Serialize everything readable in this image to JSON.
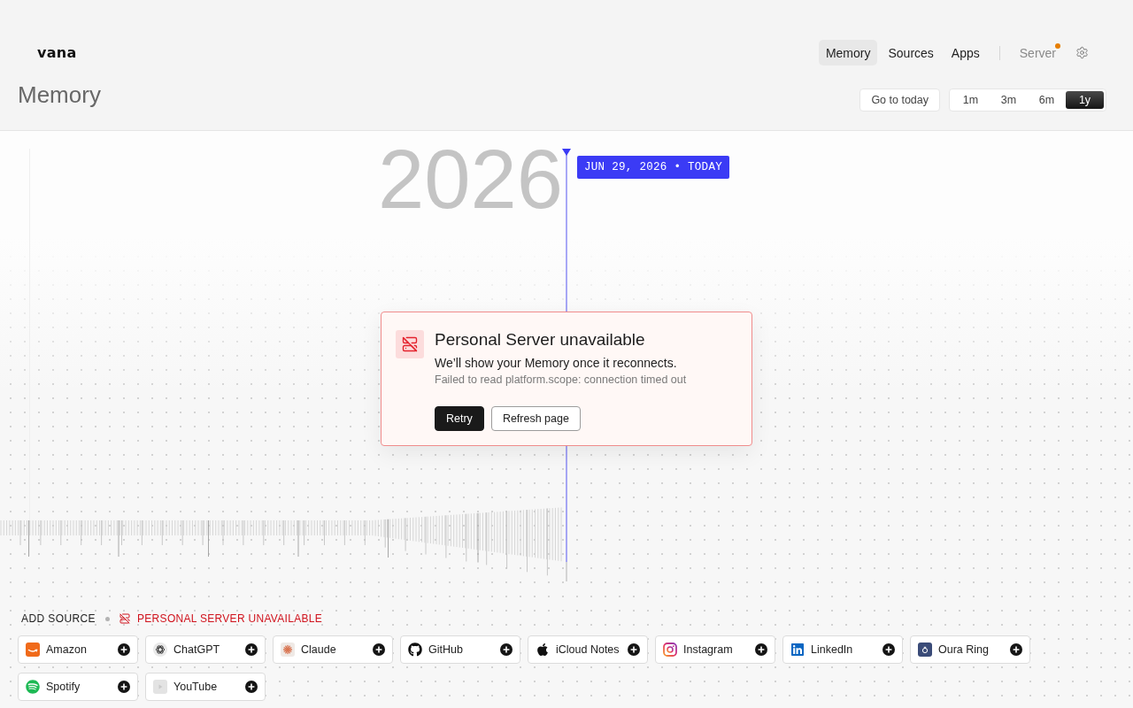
{
  "header": {
    "logo": "vana",
    "nav": [
      {
        "label": "Memory",
        "selected": true
      },
      {
        "label": "Sources",
        "selected": false
      },
      {
        "label": "Apps",
        "selected": false
      }
    ],
    "server_link": {
      "label": "Server",
      "alert": true
    }
  },
  "page_title": "Memory",
  "toolbar": {
    "today_button": "Go to today",
    "ranges": [
      {
        "label": "1m",
        "selected": false
      },
      {
        "label": "3m",
        "selected": false
      },
      {
        "label": "6m",
        "selected": false
      },
      {
        "label": "1y",
        "selected": true
      }
    ]
  },
  "timeline": {
    "year_label": "2026",
    "today_badge": "JUN 29, 2026 • TODAY"
  },
  "error_dialog": {
    "title": "Personal Server unavailable",
    "message": "We’ll show your Memory once it reconnects.",
    "detail": "Failed to read platform.scope: connection timed out",
    "buttons": [
      {
        "label": "Retry",
        "kind": "primary"
      },
      {
        "label": "Refresh page",
        "kind": "secondary"
      }
    ]
  },
  "add_source": {
    "heading": "ADD SOURCE",
    "status": "PERSONAL SERVER UNAVAILABLE",
    "sources": [
      {
        "name": "Amazon"
      },
      {
        "name": "ChatGPT"
      },
      {
        "name": "Claude"
      },
      {
        "name": "GitHub"
      },
      {
        "name": "iCloud Notes"
      },
      {
        "name": "Instagram"
      },
      {
        "name": "LinkedIn"
      },
      {
        "name": "Oura Ring"
      },
      {
        "name": "Spotify"
      },
      {
        "name": "YouTube"
      }
    ]
  }
}
